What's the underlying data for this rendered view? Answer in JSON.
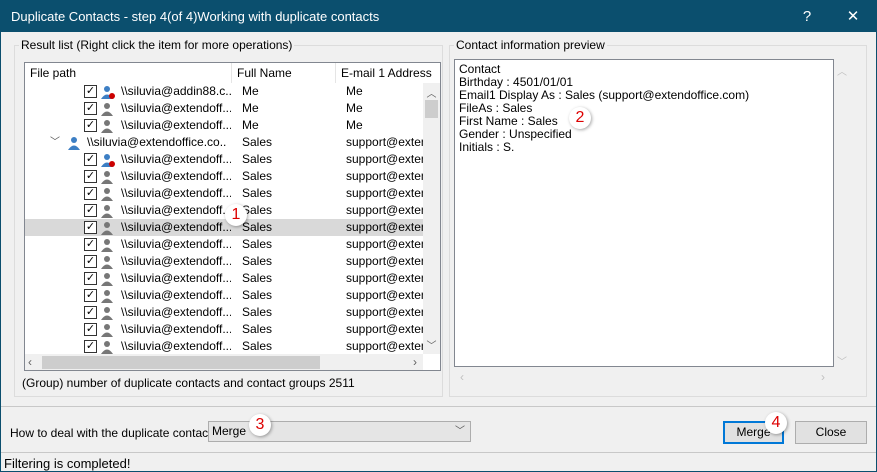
{
  "window": {
    "title": "Duplicate Contacts - step 4(of 4)Working with duplicate contacts",
    "help": "?",
    "close": "✕"
  },
  "result_list": {
    "group_label": "Result list (Right click the item for more operations)",
    "columns": [
      "File path",
      "Full Name",
      "E-mail 1 Address"
    ],
    "rows": [
      {
        "type": "child",
        "checked": true,
        "icon": "contact-red",
        "path": "\\\\siluvia@addin88.c...",
        "name": "Me",
        "email": "Me"
      },
      {
        "type": "child",
        "checked": true,
        "icon": "contact-gray",
        "path": "\\\\siluvia@extendoff...",
        "name": "Me",
        "email": "Me"
      },
      {
        "type": "child",
        "checked": true,
        "icon": "contact-gray",
        "path": "\\\\siluvia@extendoff...",
        "name": "Me",
        "email": "Me"
      },
      {
        "type": "group",
        "icon": "contact-blue",
        "path": "\\\\siluvia@extendoffice.co...",
        "name": "Sales",
        "email": "support@exten"
      },
      {
        "type": "child",
        "checked": true,
        "icon": "contact-red",
        "path": "\\\\siluvia@extendoff...",
        "name": "Sales",
        "email": "support@exten"
      },
      {
        "type": "child",
        "checked": true,
        "icon": "contact-gray",
        "path": "\\\\siluvia@extendoff...",
        "name": "Sales",
        "email": "support@exten"
      },
      {
        "type": "child",
        "checked": true,
        "icon": "contact-gray",
        "path": "\\\\siluvia@extendoff...",
        "name": "Sales",
        "email": "support@exten"
      },
      {
        "type": "child",
        "checked": true,
        "icon": "contact-gray",
        "path": "\\\\siluvia@extendoff...",
        "name": "Sales",
        "email": "support@exten"
      },
      {
        "type": "child",
        "checked": true,
        "icon": "contact-gray",
        "path": "\\\\siluvia@extendoff...",
        "name": "Sales",
        "email": "support@exten",
        "selected": true
      },
      {
        "type": "child",
        "checked": true,
        "icon": "contact-gray",
        "path": "\\\\siluvia@extendoff...",
        "name": "Sales",
        "email": "support@exten"
      },
      {
        "type": "child",
        "checked": true,
        "icon": "contact-gray",
        "path": "\\\\siluvia@extendoff...",
        "name": "Sales",
        "email": "support@exten"
      },
      {
        "type": "child",
        "checked": true,
        "icon": "contact-gray",
        "path": "\\\\siluvia@extendoff...",
        "name": "Sales",
        "email": "support@exten"
      },
      {
        "type": "child",
        "checked": true,
        "icon": "contact-gray",
        "path": "\\\\siluvia@extendoff...",
        "name": "Sales",
        "email": "support@exten"
      },
      {
        "type": "child",
        "checked": true,
        "icon": "contact-gray",
        "path": "\\\\siluvia@extendoff...",
        "name": "Sales",
        "email": "support@exten"
      },
      {
        "type": "child",
        "checked": true,
        "icon": "contact-gray",
        "path": "\\\\siluvia@extendoff...",
        "name": "Sales",
        "email": "support@exten"
      },
      {
        "type": "child",
        "checked": true,
        "icon": "contact-gray",
        "path": "\\\\siluvia@extendoff...",
        "name": "Sales",
        "email": "support@exten"
      }
    ],
    "count_label": "(Group) number of duplicate contacts and contact groups",
    "count_value": "2511"
  },
  "preview": {
    "group_label": "Contact information preview",
    "lines": [
      "Contact",
      "Birthday : 4501/01/01",
      "Email1 Display As : Sales (support@extendoffice.com)",
      "FileAs : Sales",
      "First Name : Sales",
      "Gender : Unspecified",
      "Initials : S."
    ]
  },
  "action": {
    "label": "How to deal with the duplicate contacts?",
    "selected": "Merge",
    "merge_button": "Merge",
    "close_button": "Close"
  },
  "markers": [
    "1",
    "2",
    "3",
    "4"
  ],
  "status": "Filtering is completed!",
  "colors": {
    "titlebar": "#0b4f6e",
    "selection": "#d9d9d9",
    "marker": "#dd0000",
    "contact_blue": "#3d7fc4"
  }
}
